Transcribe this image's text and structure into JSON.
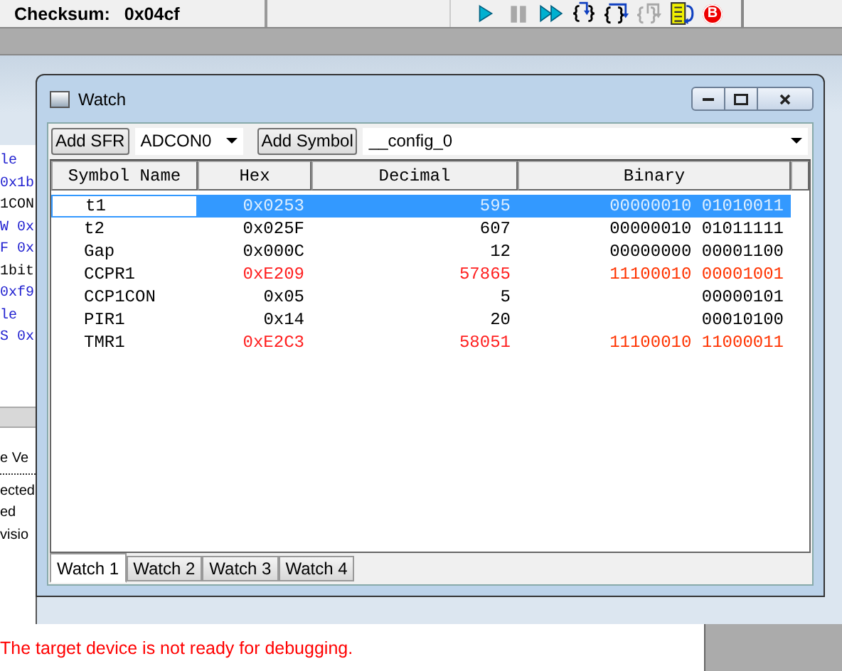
{
  "status": {
    "checksum_label": "Checksum:",
    "checksum_value": "0x04cf"
  },
  "debug_toolbar": [
    {
      "kind": "run",
      "disabled": false
    },
    {
      "kind": "halt",
      "disabled": true
    },
    {
      "kind": "animate",
      "disabled": false
    },
    {
      "kind": "step-into",
      "disabled": false
    },
    {
      "kind": "step-over",
      "disabled": false
    },
    {
      "kind": "step-out",
      "disabled": true
    },
    {
      "kind": "reset",
      "disabled": false
    },
    {
      "kind": "breakpoints",
      "disabled": false,
      "glyph": "B"
    }
  ],
  "editor_fragments": [
    {
      "text": "le",
      "kind": "keyword"
    },
    {
      "text": "0x1b",
      "kind": "keyword"
    },
    {
      "text": "1CON",
      "kind": "plain"
    },
    {
      "text": "W 0x",
      "kind": "keyword"
    },
    {
      "text": "F 0x",
      "kind": "keyword"
    },
    {
      "text": "1bit",
      "kind": "plain"
    },
    {
      "text": "0xf9",
      "kind": "keyword"
    },
    {
      "text": "le",
      "kind": "keyword"
    },
    {
      "text": "S 0x",
      "kind": "keyword"
    }
  ],
  "output_fragments": [
    "e Ve",
    "ected",
    "ed",
    "visio"
  ],
  "output_message": "The target device is not ready for debugging.",
  "watch": {
    "title": "Watch",
    "add_sfr_button": "Add SFR",
    "sfr_combo": "ADCON0",
    "add_symbol_button": "Add Symbol",
    "symbol_combo": "__config_0",
    "columns": [
      "Symbol Name",
      "Hex",
      "Decimal",
      "Binary"
    ],
    "rows": [
      {
        "name": "t1",
        "hex": "0x0253",
        "decimal": "595",
        "binary": "00000010 01010011",
        "selected": true,
        "changed": false
      },
      {
        "name": "t2",
        "hex": "0x025F",
        "decimal": "607",
        "binary": "00000010 01011111",
        "selected": false,
        "changed": false
      },
      {
        "name": "Gap",
        "hex": "0x000C",
        "decimal": "12",
        "binary": "00000000 00001100",
        "selected": false,
        "changed": false
      },
      {
        "name": "CCPR1",
        "hex": "0xE209",
        "decimal": "57865",
        "binary": "11100010 00001001",
        "selected": false,
        "changed": true
      },
      {
        "name": "CCP1CON",
        "hex": "0x05",
        "decimal": "5",
        "binary": "00000101",
        "selected": false,
        "changed": false
      },
      {
        "name": "PIR1",
        "hex": "0x14",
        "decimal": "20",
        "binary": "00010100",
        "selected": false,
        "changed": false
      },
      {
        "name": "TMR1",
        "hex": "0xE2C3",
        "decimal": "58051",
        "binary": "11100010 11000011",
        "selected": false,
        "changed": true
      }
    ],
    "tabs": [
      {
        "label": "Watch 1",
        "selected": true
      },
      {
        "label": "Watch 2",
        "selected": false
      },
      {
        "label": "Watch 3",
        "selected": false
      },
      {
        "label": "Watch 4",
        "selected": false
      }
    ]
  }
}
